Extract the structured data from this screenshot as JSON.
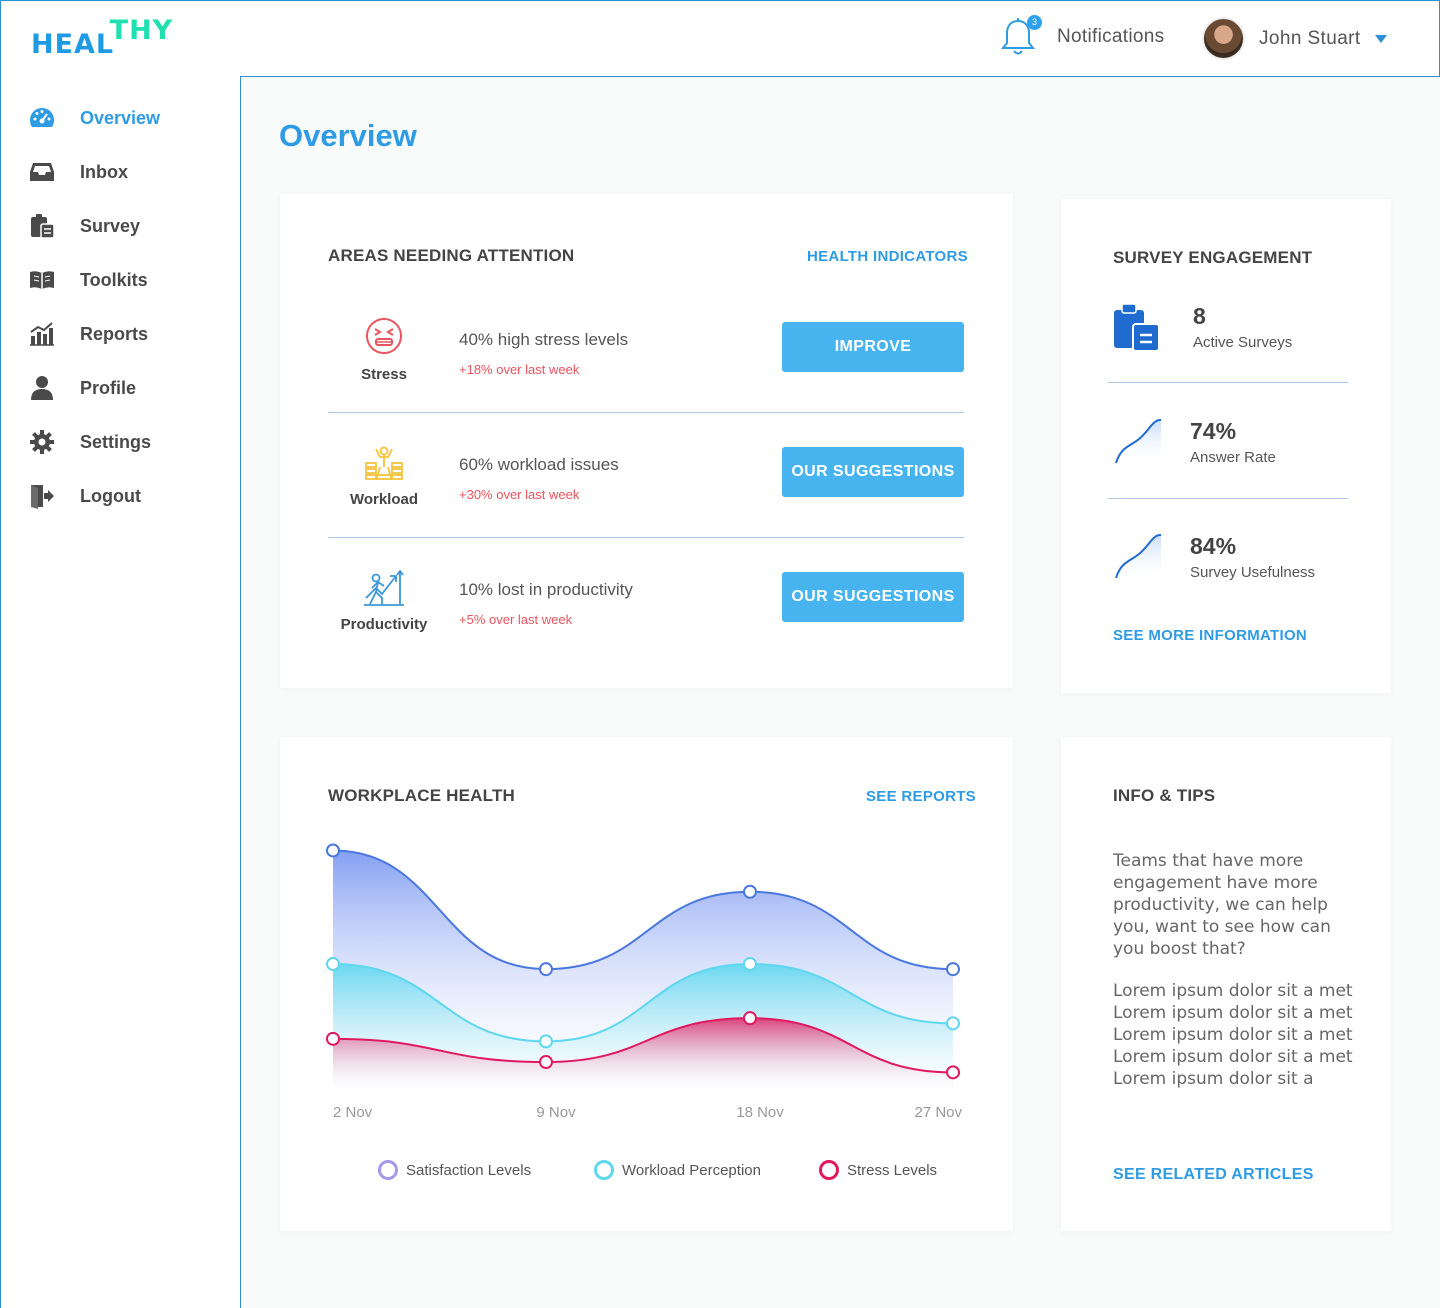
{
  "app": {
    "logo_part1": "HEAL",
    "logo_part2": "THY"
  },
  "header": {
    "notification_count": "3",
    "notifications_label": "Notifications",
    "user_name": "John Stuart"
  },
  "sidebar": {
    "items": [
      {
        "label": "Overview",
        "icon": "dashboard-icon",
        "active": true
      },
      {
        "label": "Inbox",
        "icon": "inbox-icon"
      },
      {
        "label": "Survey",
        "icon": "clipboard-icon"
      },
      {
        "label": "Toolkits",
        "icon": "book-icon"
      },
      {
        "label": "Reports",
        "icon": "chart-icon"
      },
      {
        "label": "Profile",
        "icon": "person-icon"
      },
      {
        "label": "Settings",
        "icon": "gear-icon"
      },
      {
        "label": "Logout",
        "icon": "logout-icon"
      }
    ]
  },
  "page": {
    "title": "Overview"
  },
  "areas": {
    "title": "AREAS NEEDING ATTENTION",
    "link": "HEALTH INDICATORS",
    "rows": [
      {
        "name": "Stress",
        "icon": "stressed-face-icon",
        "metric": "40% high stress levels",
        "change": "+18% over last week",
        "button": "IMPROVE"
      },
      {
        "name": "Workload",
        "icon": "workload-icon",
        "metric": "60% workload issues",
        "change": "+30% over last week",
        "button": "OUR SUGGESTIONS"
      },
      {
        "name": "Productivity",
        "icon": "productivity-icon",
        "metric": "10% lost in productivity",
        "change": "+5% over last week",
        "button": "OUR SUGGESTIONS"
      }
    ]
  },
  "survey": {
    "title": "SURVEY ENGAGEMENT",
    "active_value": "8",
    "active_label": "Active Surveys",
    "answer_value": "74%",
    "answer_label": "Answer Rate",
    "useful_value": "84%",
    "useful_label": "Survey Usefulness",
    "link": "SEE MORE INFORMATION"
  },
  "workplace": {
    "title": "WORKPLACE HEALTH",
    "link": "SEE REPORTS"
  },
  "chart_data": {
    "type": "area",
    "x": [
      "2 Nov",
      "9 Nov",
      "18 Nov",
      "27 Nov"
    ],
    "ylim": [
      0,
      100
    ],
    "grid": false,
    "legend_position": "bottom",
    "series": [
      {
        "name": "Satisfaction Levels",
        "color": "#4b78e0",
        "legend_color": "#a39ae8",
        "values": [
          94,
          48,
          78,
          48
        ]
      },
      {
        "name": "Workload Perception",
        "color": "#5fd7ef",
        "legend_color": "#5fd7ef",
        "values": [
          50,
          20,
          50,
          27
        ]
      },
      {
        "name": "Stress Levels",
        "color": "#e0195e",
        "legend_color": "#e0195e",
        "values": [
          21,
          12,
          29,
          8
        ]
      }
    ]
  },
  "tips": {
    "title": "INFO & TIPS",
    "paragraph1": "Teams that have more engagement have more productivity, we can help you, want to see how can you boost that?",
    "paragraph2": "Lorem ipsum dolor sit a met Lorem ipsum dolor sit a met Lorem ipsum dolor sit a met Lorem ipsum dolor sit a met Lorem ipsum dolor sit a",
    "link": "SEE RELATED ARTICLES"
  }
}
